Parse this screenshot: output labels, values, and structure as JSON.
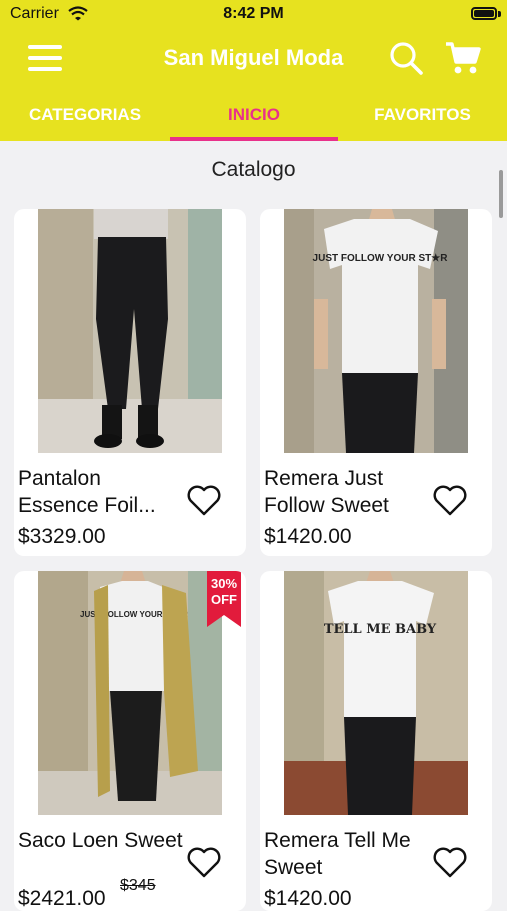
{
  "status_bar": {
    "carrier": "Carrier",
    "time": "8:42 PM"
  },
  "header": {
    "title": "San Miguel Moda",
    "icons": [
      "menu-icon",
      "search-icon",
      "cart-icon"
    ]
  },
  "tabs": [
    {
      "label": "CATEGORIAS",
      "active": false
    },
    {
      "label": "INICIO",
      "active": true
    },
    {
      "label": "FAVORITOS",
      "active": false
    }
  ],
  "catalog": {
    "title": "Catalogo",
    "products": [
      {
        "name": "Pantalon Essence Foil...",
        "price": "$3329.00",
        "old_price": "",
        "badge": ""
      },
      {
        "name": "Remera Just Follow Sweet",
        "price": "$1420.00",
        "old_price": "",
        "badge": ""
      },
      {
        "name": "Saco Loen Sweet",
        "price": "$2421.00",
        "old_price": "$345",
        "badge": "30% OFF"
      },
      {
        "name": "Remera  Tell Me Sweet",
        "price": "$1420.00",
        "old_price": "",
        "badge": ""
      }
    ],
    "shirt_prints": [
      "JUST FOLLOW YOUR ST★R",
      "TELL ME BABY"
    ]
  },
  "colors": {
    "header_bg": "#e7e21f",
    "accent": "#e8318a",
    "header_text": "#ffffff",
    "badge": "#e21b3c",
    "background": "#f1f1f3"
  }
}
